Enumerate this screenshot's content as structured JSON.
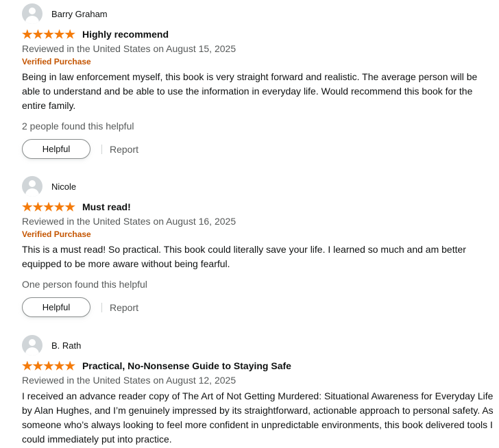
{
  "colors": {
    "star": "#f47b0b",
    "verified": "#c45500",
    "muted_text": "#565959"
  },
  "reviews": [
    {
      "name": "Barry Graham",
      "rating": 5,
      "title": "Highly recommend",
      "date": "Reviewed in the United States on August 15, 2025",
      "verified": "Verified Purchase",
      "body": "Being in law enforcement myself, this book is very straight forward and realistic. The average person will be able to understand and be able to use the information in everyday life. Would recommend this book for the entire family.",
      "helpful_count": "2 people found this helpful",
      "helpful_label": "Helpful",
      "report_label": "Report"
    },
    {
      "name": "Nicole",
      "rating": 5,
      "title": "Must read!",
      "date": "Reviewed in the United States on August 16, 2025",
      "verified": "Verified Purchase",
      "body": "This is a must read! So practical. This book could literally save your life. I learned so much and am better equipped to be more aware without being fearful.",
      "helpful_count": "One person found this helpful",
      "helpful_label": "Helpful",
      "report_label": "Report"
    },
    {
      "name": "B. Rath",
      "rating": 5,
      "title": "Practical, No-Nonsense Guide to Staying Safe",
      "date": "Reviewed in the United States on August 12, 2025",
      "body": "I received an advance reader copy of The Art of Not Getting Murdered: Situational Awareness for Everyday Life by Alan Hughes, and I’m genuinely impressed by its straightforward, actionable approach to personal safety. As someone who’s always looking to feel more confident in unpredictable environments, this book delivered tools I could immediately put into practice."
    }
  ]
}
